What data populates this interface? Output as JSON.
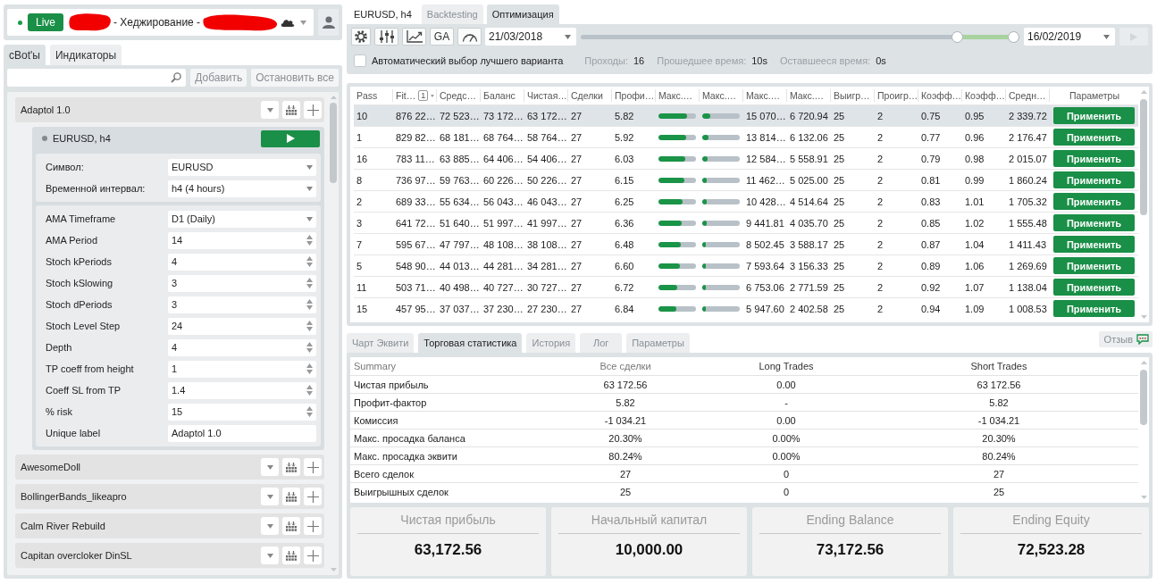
{
  "account": {
    "connected": true,
    "mode": "Live",
    "name": "- Хеджирование -"
  },
  "left_tabs": [
    {
      "label": "сBot'ы",
      "selected": true
    },
    {
      "label": "Индикаторы",
      "selected": false
    }
  ],
  "bot_toolbar": {
    "buttons": [
      "Добавить",
      "Остановить все"
    ]
  },
  "bots": [
    {
      "name": "Adaptol 1.0",
      "instances": [
        {
          "title": "EURUSD, h4",
          "running": false,
          "settings": [
            {
              "label": "Символ:",
              "value": "EURUSD",
              "kind": "select"
            },
            {
              "label": "Временной интервал:",
              "value": "h4 (4 hours)",
              "kind": "select"
            }
          ],
          "parameters": [
            {
              "label": "AMA Timeframe",
              "value": "D1 (Daily)",
              "kind": "select"
            },
            {
              "label": "AMA Period",
              "value": "14",
              "kind": "number"
            },
            {
              "label": "Stoch kPeriods",
              "value": "4",
              "kind": "number"
            },
            {
              "label": "Stoch kSlowing",
              "value": "3",
              "kind": "number"
            },
            {
              "label": "Stoch dPeriods",
              "value": "3",
              "kind": "number"
            },
            {
              "label": "Stoch Level Step",
              "value": "24",
              "kind": "number"
            },
            {
              "label": "Depth",
              "value": "4",
              "kind": "number"
            },
            {
              "label": "TP coeff from height",
              "value": "1",
              "kind": "number"
            },
            {
              "label": "Coeff SL from TP",
              "value": "1.4",
              "kind": "number"
            },
            {
              "label": "% risk",
              "value": "15",
              "kind": "number"
            },
            {
              "label": "Unique label",
              "value": "Adaptol 1.0",
              "kind": "text"
            }
          ]
        }
      ]
    },
    {
      "name": "AwesomeDoll"
    },
    {
      "name": "BollingerBands_likeapro"
    },
    {
      "name": "Calm River Rebuild"
    },
    {
      "name": "Capitan overcloker DinSL"
    }
  ],
  "instance_label": "EURUSD, h4",
  "tabs": [
    {
      "label": "Backtesting",
      "selected": false
    },
    {
      "label": "Оптимизация",
      "selected": true
    }
  ],
  "toolbar": {
    "ga_label": "GA",
    "start_date": "21/03/2018",
    "end_date": "16/02/2019",
    "range_start": {
      "level": 0.87
    },
    "range_end": {
      "level": 1
    },
    "run_disabled": true
  },
  "options": {
    "auto_select": {
      "label": "Автоматический выбор лучшего варианта",
      "checked": false
    },
    "stats": [
      {
        "label": "Проходы:",
        "value": "16"
      },
      {
        "label": "Прошедшее время:",
        "value": "10s"
      },
      {
        "label": "Оставшееся время:",
        "value": "0s"
      }
    ]
  },
  "passes_table": {
    "columns": [
      {
        "label": "Pass",
        "kind": "text"
      },
      {
        "label": "Fit…",
        "kind": "text",
        "sort_rank": "1"
      },
      {
        "label": "Средс…",
        "kind": "text"
      },
      {
        "label": "Баланс",
        "kind": "text"
      },
      {
        "label": "Чистая…",
        "kind": "text"
      },
      {
        "label": "Сделки",
        "kind": "text"
      },
      {
        "label": "Профи…",
        "kind": "text"
      },
      {
        "label": "Макс.…",
        "kind": "bar"
      },
      {
        "label": "Макс.…",
        "kind": "bar"
      },
      {
        "label": "Макс.…",
        "kind": "text"
      },
      {
        "label": "Макс.…",
        "kind": "text"
      },
      {
        "label": "Выигр…",
        "kind": "text"
      },
      {
        "label": "Проигр…",
        "kind": "text"
      },
      {
        "label": "Коэфф…",
        "kind": "text"
      },
      {
        "label": "Коэфф…",
        "kind": "text"
      },
      {
        "label": "Средн…",
        "kind": "text"
      },
      {
        "label": "Параметры",
        "kind": "button"
      }
    ],
    "rows": [
      {
        "selected": true,
        "cells": [
          "10",
          "876 22…",
          "72 523…",
          "73 172…",
          "63 172…",
          "27",
          "5.82",
          {
            "level": 0.77
          },
          {
            "level": 0.22
          },
          "15 070…",
          "6 720.94",
          "25",
          "2",
          "0.75",
          "0.95",
          "2 339.72",
          "Применить"
        ]
      },
      {
        "selected": false,
        "cells": [
          "1",
          "829 82…",
          "68 181…",
          "68 764…",
          "58 764…",
          "27",
          "5.92",
          {
            "level": 0.74
          },
          {
            "level": 0.17
          },
          "13 814…",
          "6 132.06",
          "25",
          "2",
          "0.77",
          "0.96",
          "2 176.47",
          "Применить"
        ]
      },
      {
        "selected": false,
        "cells": [
          "16",
          "783 11…",
          "63 885…",
          "64 406…",
          "54 406…",
          "27",
          "6.03",
          {
            "level": 0.71
          },
          {
            "level": 0.15
          },
          "12 584…",
          "5 558.91",
          "25",
          "2",
          "0.79",
          "0.98",
          "2 015.07",
          "Применить"
        ]
      },
      {
        "selected": false,
        "cells": [
          "8",
          "736 97…",
          "59 763…",
          "60 226…",
          "50 226…",
          "27",
          "6.15",
          {
            "level": 0.69
          },
          {
            "level": 0.13
          },
          "11 462…",
          "5 025.00",
          "25",
          "2",
          "0.81",
          "0.99",
          "1 860.24",
          "Применить"
        ]
      },
      {
        "selected": false,
        "cells": [
          "2",
          "689 33…",
          "55 634…",
          "56 043…",
          "46 043…",
          "27",
          "6.25",
          {
            "level": 0.64
          },
          {
            "level": 0.12
          },
          "10 428…",
          "4 514.64",
          "25",
          "2",
          "0.83",
          "1.01",
          "1 705.32",
          "Применить"
        ]
      },
      {
        "selected": false,
        "cells": [
          "3",
          "641 72…",
          "51 640…",
          "51 997…",
          "41 997…",
          "27",
          "6.36",
          {
            "level": 0.61
          },
          {
            "level": 0.11
          },
          "9 441.81",
          "4 035.70",
          "25",
          "2",
          "0.85",
          "1.02",
          "1 555.48",
          "Применить"
        ]
      },
      {
        "selected": false,
        "cells": [
          "7",
          "595 67…",
          "47 797…",
          "48 108…",
          "38 108…",
          "27",
          "6.48",
          {
            "level": 0.6
          },
          {
            "level": 0.1
          },
          "8 502.45",
          "3 588.17",
          "25",
          "2",
          "0.87",
          "1.04",
          "1 411.43",
          "Применить"
        ]
      },
      {
        "selected": false,
        "cells": [
          "5",
          "548 90…",
          "44 013…",
          "44 281…",
          "34 281…",
          "27",
          "6.60",
          {
            "level": 0.57
          },
          {
            "level": 0.1
          },
          "7 593.64",
          "3 156.33",
          "25",
          "2",
          "0.89",
          "1.06",
          "1 269.69",
          "Применить"
        ]
      },
      {
        "selected": false,
        "cells": [
          "11",
          "503 71…",
          "40 498…",
          "40 727…",
          "30 727…",
          "27",
          "6.72",
          {
            "level": 0.51
          },
          {
            "level": 0.09
          },
          "6 753.06",
          "2 771.59",
          "25",
          "2",
          "0.92",
          "1.07",
          "1 138.04",
          "Применить"
        ]
      },
      {
        "selected": false,
        "cells": [
          "15",
          "457 95…",
          "37 037…",
          "37 230…",
          "27 230…",
          "27",
          "6.84",
          {
            "level": 0.47
          },
          {
            "level": 0.09
          },
          "5 947.60",
          "2 402.58",
          "25",
          "2",
          "0.94",
          "1.09",
          "1 008.53",
          "Применить"
        ]
      }
    ]
  },
  "result_tabs": [
    {
      "label": "Чарт Эквити",
      "selected": false
    },
    {
      "label": "Торговая статистика",
      "selected": true
    },
    {
      "label": "История",
      "selected": false
    },
    {
      "label": "Лог",
      "selected": false
    },
    {
      "label": "Параметры",
      "selected": false
    }
  ],
  "feedback_button": "Отзыв",
  "trade_stats": {
    "columns": [
      "Summary",
      "Все сделки",
      "Long Trades",
      "Short Trades"
    ],
    "rows": [
      [
        "Чистая прибыль",
        "63 172.56",
        "0.00",
        "63 172.56"
      ],
      [
        "Профит-фактор",
        "5.82",
        "-",
        "5.82"
      ],
      [
        "Комиссия",
        "-1 034.21",
        "0.00",
        "-1 034.21"
      ],
      [
        "Макс. просадка баланса",
        "20.30%",
        "0.00%",
        "20.30%"
      ],
      [
        "Макс. просадка эквити",
        "80.24%",
        "0.00%",
        "80.24%"
      ],
      [
        "Всего сделок",
        "27",
        "0",
        "27"
      ],
      [
        "Выигрышных сделок",
        "25",
        "0",
        "25"
      ]
    ]
  },
  "summary_cards": [
    {
      "title": "Чистая прибыль",
      "value": "63,172.56"
    },
    {
      "title": "Начальный капитал",
      "value": "10,000.00"
    },
    {
      "title": "Ending Balance",
      "value": "73,172.56"
    },
    {
      "title": "Ending Equity",
      "value": "72,523.28"
    }
  ]
}
